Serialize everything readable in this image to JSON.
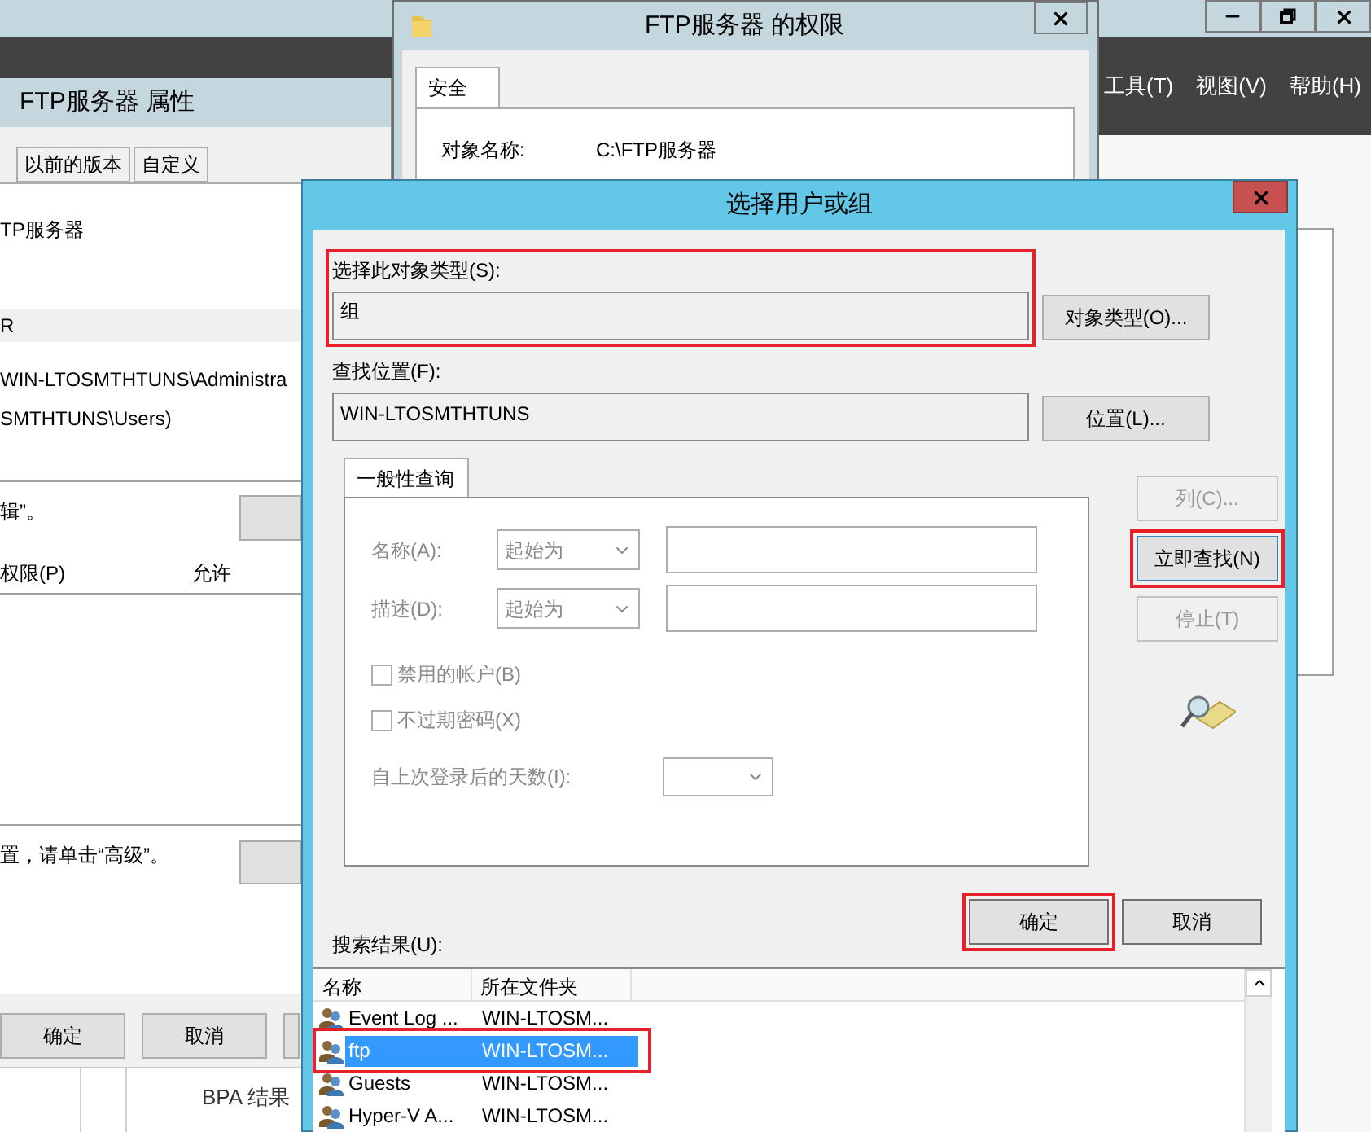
{
  "server_manager": {
    "menu": [
      "工具(T)",
      "视图(V)",
      "帮助(H)"
    ],
    "table_text": "BPA 结果"
  },
  "properties_window": {
    "title": "FTP服务器 属性",
    "tabs": [
      {
        "label": "以前的版本",
        "selected": false
      },
      {
        "label": "自定义",
        "selected": false
      }
    ],
    "object_name": "TP服务器",
    "group_header": "R",
    "users": [
      "WIN-LTOSMTHTUNS\\Administra",
      "SMTHTUNS\\Users)"
    ],
    "edit_hint": "辑”。",
    "permission_columns": [
      "权限(P)",
      "允许"
    ],
    "advanced_hint": "置，请单击“高级”。",
    "buttons": [
      "确定",
      "取消"
    ]
  },
  "permissions_window": {
    "title": "FTP服务器 的权限",
    "tab": "安全",
    "object_label": "对象名称:",
    "object_value": "C:\\FTP服务器"
  },
  "dialog": {
    "title": "选择用户或组",
    "object_type_label": "选择此对象类型(S):",
    "object_type": "组",
    "object_type_marked": true,
    "object_type_button": "对象类型(O)...",
    "location_label": "查找位置(F):",
    "location": "WIN-LTOSMTHTUNS",
    "location_button": "位置(L)...",
    "tab": "一般性查询",
    "query_fields": [
      {
        "label": "名称(A):",
        "operator": "起始为"
      },
      {
        "label": "描述(D):",
        "operator": "起始为"
      }
    ],
    "checkboxes": [
      {
        "label": "禁用的帐户(B)",
        "checked": false
      },
      {
        "label": "不过期密码(X)",
        "checked": false
      }
    ],
    "days_label": "自上次登录后的天数(I):",
    "side_buttons": [
      {
        "label": "列(C)...",
        "disabled": true,
        "marked": false
      },
      {
        "label": "立即查找(N)",
        "disabled": false,
        "marked": true
      },
      {
        "label": "停止(T)",
        "disabled": true,
        "marked": false
      }
    ],
    "ok_button": {
      "label": "确定",
      "marked": true
    },
    "cancel_button": "取消",
    "results_label": "搜索结果(U):",
    "result_columns": [
      "名称",
      "所在文件夹"
    ],
    "results": [
      {
        "name": "Event Log ...",
        "folder": "WIN-LTOSM...",
        "selected": false,
        "marked": false
      },
      {
        "name": "ftp",
        "folder": "WIN-LTOSM...",
        "selected": true,
        "marked": true
      },
      {
        "name": "Guests",
        "folder": "WIN-LTOSM...",
        "selected": false,
        "marked": false
      },
      {
        "name": "Hyper-V A...",
        "folder": "WIN-LTOSM...",
        "selected": false,
        "marked": false
      }
    ]
  }
}
